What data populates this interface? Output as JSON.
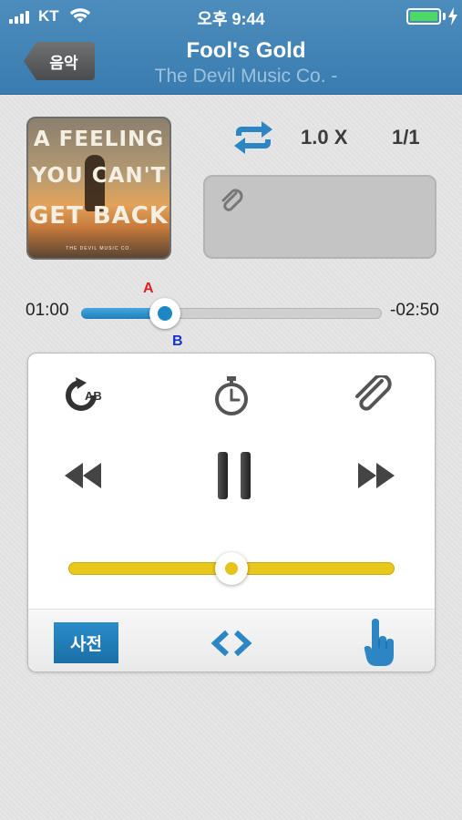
{
  "status_bar": {
    "carrier": "KT",
    "time": "오후 9:44",
    "battery_level": 1.0,
    "battery_color": "#4cd964"
  },
  "nav": {
    "back_label": "음악",
    "title": "Fool's Gold",
    "subtitle": "The Devil Music Co. -",
    "bar_color": "#3f82b5"
  },
  "album_art": {
    "lines": [
      "A FEELING",
      "YOU CAN'T",
      "GET BACK"
    ],
    "small_text": "THE DEVIL MUSIC CO."
  },
  "controls": {
    "repeat_icon": "repeat-icon",
    "speed": "1.0 X",
    "counter": "1/1",
    "memo_icon": "paperclip-icon"
  },
  "progress": {
    "current": "01:00",
    "remaining": "-02:50",
    "fraction": 0.28,
    "marker_a": "A",
    "marker_b": "B",
    "accent": "#1f86c5"
  },
  "panel": {
    "ab_icon": "ab-repeat-icon",
    "timer_icon": "stopwatch-icon",
    "attach_icon": "paperclip-icon",
    "rewind_icon": "rewind-icon",
    "pause_icon": "pause-icon",
    "forward_icon": "fast-forward-icon",
    "volume_fraction": 0.5,
    "volume_color": "#e8c81c",
    "dict_label": "사전",
    "code_icon": "code-arrows-icon",
    "hand_icon": "pointing-hand-icon"
  }
}
